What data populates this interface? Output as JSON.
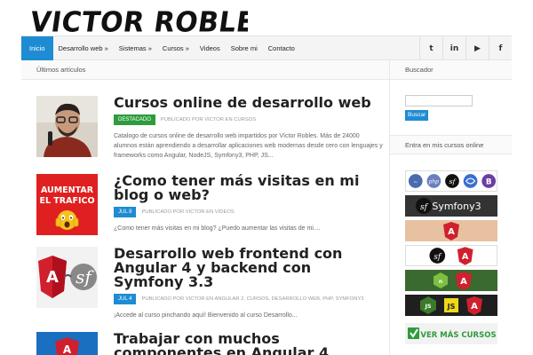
{
  "site": {
    "logo": "VICTOR ROBLES"
  },
  "nav": {
    "items": [
      "Inicio",
      "Desarrollo web »",
      "Sistemas »",
      "Cursos »",
      "Videos",
      "Sobre mi",
      "Contacto"
    ],
    "active": "Inicio",
    "social_icons": [
      "twitter-icon",
      "linkedin-icon",
      "youtube-icon",
      "facebook-icon"
    ],
    "social_glyphs": [
      "t",
      "in",
      "▶",
      "f"
    ]
  },
  "main": {
    "section_title": "Últimos artículos",
    "articles": [
      {
        "title": "Cursos online de desarrollo web",
        "badge": "DESTACADO",
        "byline": "PUBLICADO POR VICTOR EN CURSOS",
        "excerpt": "Catalogo de cursos online de desarrollo web impartidos por Víctor Robles. Más de 24000 alumnos están aprendiendo a desarrollar aplicaciones web modernas desde cero con lenguajes y frameworks como Angular, NodeJS, Symfony3, PHP, JS..."
      },
      {
        "title": "¿Como tener más visitas en mi blog o web?",
        "badge": "JUL 8",
        "byline": "PUBLICADO POR VICTOR EN VIDEOS",
        "excerpt": "¿Como tener más visitas en mi blog? ¿Puedo aumentar las visitas de mi....",
        "thumb_text": "AUMENTAR EL TRAFICO"
      },
      {
        "title": "Desarrollo web frontend con Angular 4 y backend con Symfony 3.3",
        "badge": "JUL 4",
        "byline": "PUBLICADO POR VICTOR EN ANGULAR 2, CURSOS, DESARROLLO WEB, PHP, SYMFONY3",
        "excerpt": "¡Accede al curso pinchando aquí! Bienvenido al curso Desarrollo..."
      },
      {
        "title": "Trabajar con muchos componentes en Angular 4"
      }
    ]
  },
  "sidebar": {
    "search_title": "Buscador",
    "search_button": "Buscar",
    "courses_title": "Entra en mis cursos online",
    "banner_last": "VER MÁS CURSOS",
    "banner_symfony": "Symfony3"
  },
  "colors": {
    "accent": "#1e8cd2",
    "featured": "#2e9c3c"
  }
}
